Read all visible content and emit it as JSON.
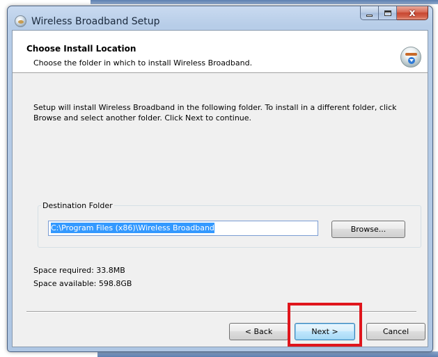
{
  "window": {
    "title": "Wireless Broadband Setup",
    "close_glyph": "x",
    "icons": [
      "app-globe-icon",
      "minimize-icon",
      "maximize-icon",
      "close-icon"
    ]
  },
  "header": {
    "title": "Choose Install Location",
    "subtitle": "Choose the folder in which to install Wireless Broadband.",
    "icon": "installer-globe-icon"
  },
  "body": {
    "description": "Setup will install Wireless Broadband in the following folder. To install in a different folder, click Browse and select another folder. Click Next to continue."
  },
  "destination": {
    "legend": "Destination Folder",
    "path": "C:\\Program Files (x86)\\Wireless Broadband",
    "browse_label": "Browse..."
  },
  "space": {
    "required": "Space required: 33.8MB",
    "available": "Space available: 598.8GB"
  },
  "buttons": {
    "back": "< Back",
    "next": "Next >",
    "cancel": "Cancel"
  },
  "colors": {
    "highlight": "#e0151c",
    "selection": "#3399ff"
  }
}
